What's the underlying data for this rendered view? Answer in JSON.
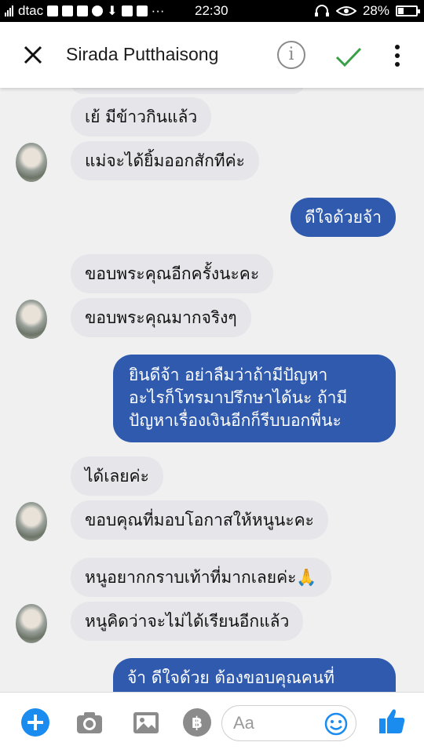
{
  "status": {
    "carrier": "dtac",
    "time": "22:30",
    "battery": "28%",
    "dots": "···"
  },
  "header": {
    "contact_name": "Sirada Putthaisong",
    "info_glyph": "i"
  },
  "messages": [
    {
      "from": "them",
      "text": "เย้ มีข้าวกินแล้ว"
    },
    {
      "from": "them",
      "text": "แม่จะได้ยิ้มออกสักทีค่ะ"
    },
    {
      "from": "me",
      "text": "ดีใจด้วยจ้า"
    },
    {
      "from": "them",
      "text": "ขอบพระคุณอีกครั้งนะคะ"
    },
    {
      "from": "them",
      "text": "ขอบพระคุณมากจริงๆ"
    },
    {
      "from": "me",
      "lines": [
        "ยินดีจ้า อย่าลืมว่าถ้ามีปัญหา",
        "อะไรก็โทรมาปรึกษาได้นะ ถ้ามี",
        "ปัญหาเรื่องเงินอีกก็รีบบอกพี่นะ"
      ]
    },
    {
      "from": "them",
      "text": "ได้เลยค่ะ"
    },
    {
      "from": "them",
      "text": "ขอบคุณที่มอบโอกาสให้หนูนะคะ"
    },
    {
      "from": "them",
      "text": "หนูอยากกราบเท้าที่มากเลยค่ะ🙏"
    },
    {
      "from": "them",
      "text": "หนูคิดว่าจะไม่ได้เรียนอีกแล้ว"
    },
    {
      "from": "me",
      "text": "จ้า ดีใจด้วย ต้องขอบคุณคนที่"
    }
  ],
  "composer": {
    "placeholder": "Aa",
    "baht_glyph": "฿"
  },
  "icons": {
    "close": "close-icon",
    "info": "info-icon",
    "check": "check-icon",
    "more": "more-vertical-icon",
    "plus": "plus-icon",
    "camera": "camera-icon",
    "gallery": "image-icon",
    "payment": "baht-icon",
    "emoji": "emoji-icon",
    "like": "thumbs-up-icon"
  },
  "colors": {
    "outgoing_bubble": "#2f5aae",
    "incoming_bubble": "#e6e5e9",
    "accent_blue": "#1a8cf0",
    "check_green": "#3aa047"
  }
}
